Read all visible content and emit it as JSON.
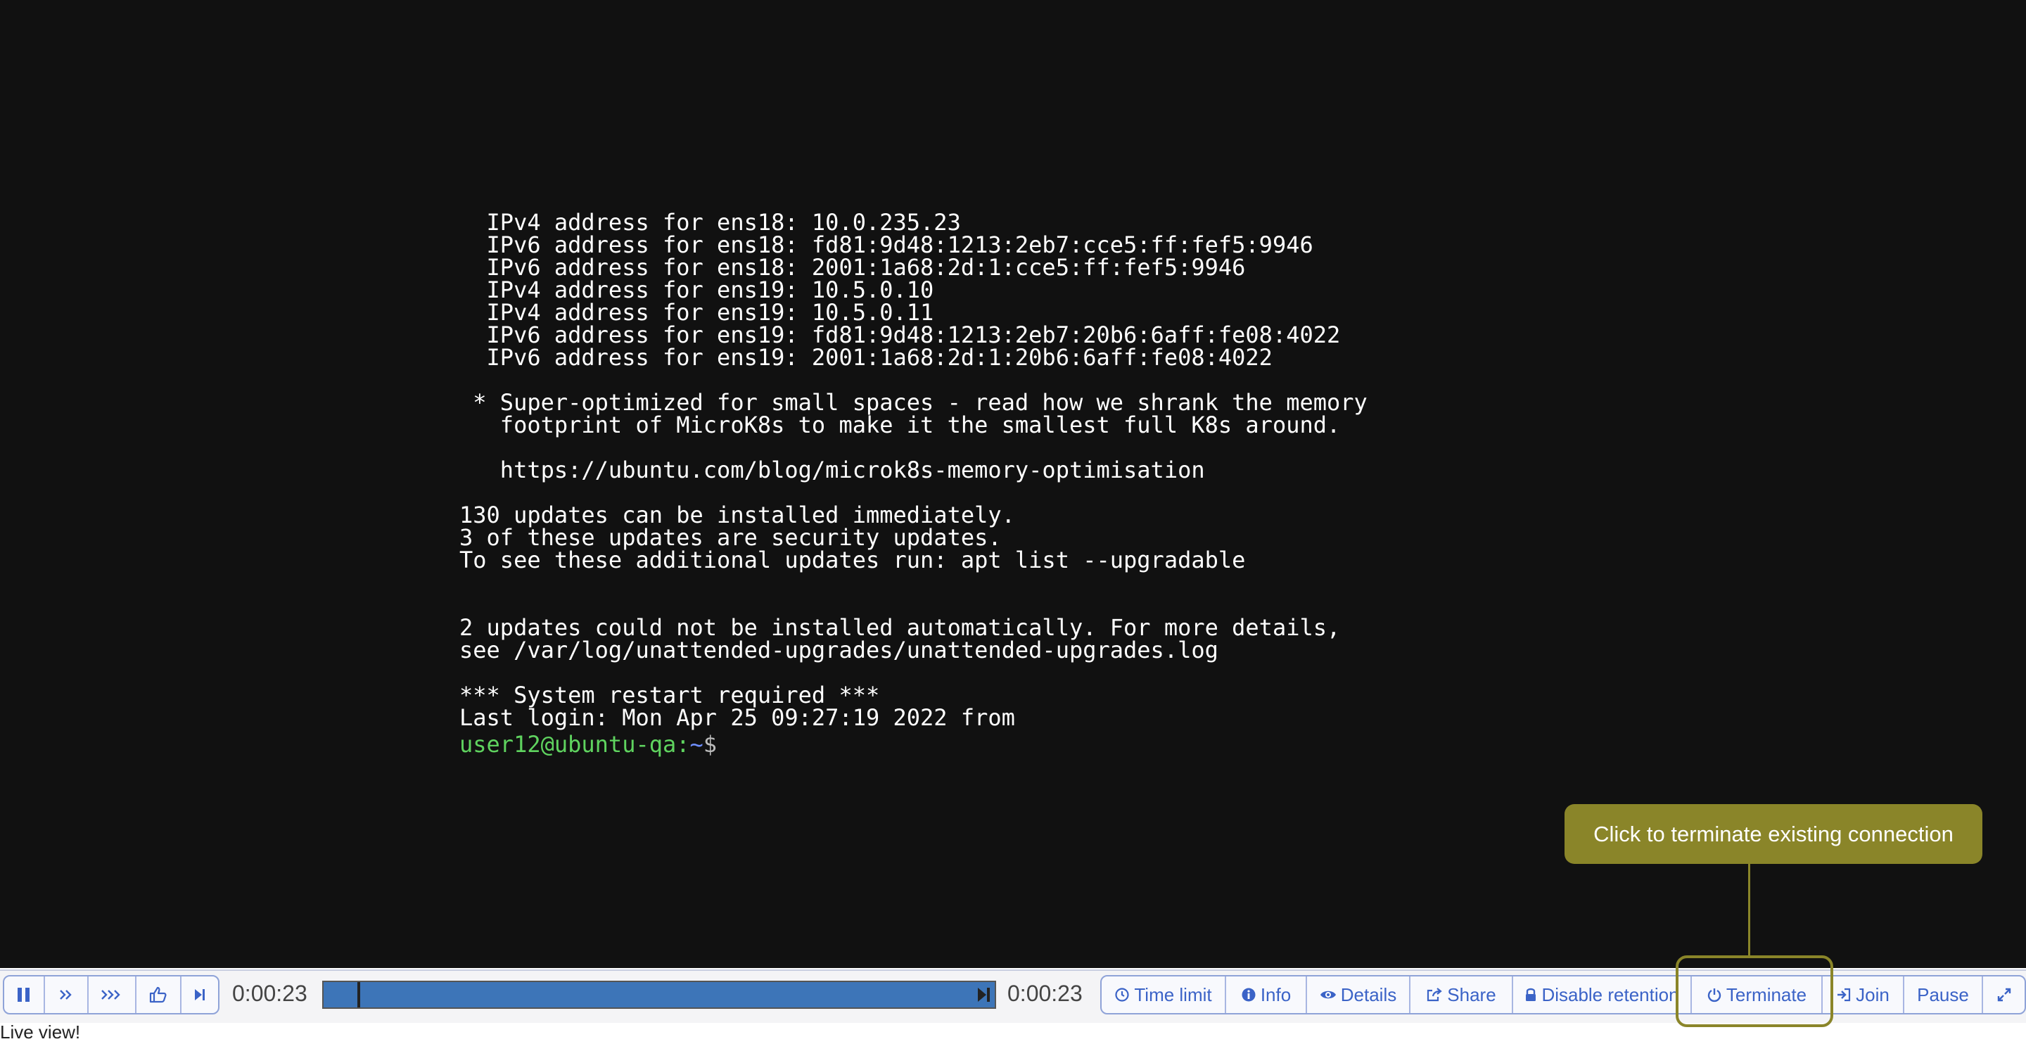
{
  "terminal": {
    "lines": [
      "  IPv4 address for ens18: 10.0.235.23",
      "  IPv6 address for ens18: fd81:9d48:1213:2eb7:cce5:ff:fef5:9946",
      "  IPv6 address for ens18: 2001:1a68:2d:1:cce5:ff:fef5:9946",
      "  IPv4 address for ens19: 10.5.0.10",
      "  IPv4 address for ens19: 10.5.0.11",
      "  IPv6 address for ens19: fd81:9d48:1213:2eb7:20b6:6aff:fe08:4022",
      "  IPv6 address for ens19: 2001:1a68:2d:1:20b6:6aff:fe08:4022",
      "",
      " * Super-optimized for small spaces - read how we shrank the memory",
      "   footprint of MicroK8s to make it the smallest full K8s around.",
      "",
      "   https://ubuntu.com/blog/microk8s-memory-optimisation",
      "",
      "130 updates can be installed immediately.",
      "3 of these updates are security updates.",
      "To see these additional updates run: apt list --upgradable",
      "",
      "",
      "2 updates could not be installed automatically. For more details,",
      "see /var/log/unattended-upgrades/unattended-upgrades.log",
      "",
      "*** System restart required ***",
      "Last login: Mon Apr 25 09:27:19 2022 from"
    ],
    "prompt": {
      "user_host": "user12@ubuntu-qa",
      "colon": ":",
      "path": "~",
      "symbol": "$"
    }
  },
  "tooltip": {
    "text": "Click to terminate existing connection"
  },
  "player": {
    "current_time": "0:00:23",
    "total_time": "0:00:23",
    "progress": 0.05
  },
  "buttons": {
    "time_limit": "Time limit",
    "info": "Info",
    "details": "Details",
    "share": "Share",
    "disable_retention": "Disable retention",
    "terminate": "Terminate",
    "join": "Join",
    "pause": "Pause"
  },
  "status": {
    "text": "Live view!"
  },
  "colors": {
    "accent": "#3b63c7",
    "tooltip": "#8a8529",
    "seek": "#3d75b8",
    "prompt_user": "#5fd35f",
    "prompt_path": "#6f8fff"
  }
}
